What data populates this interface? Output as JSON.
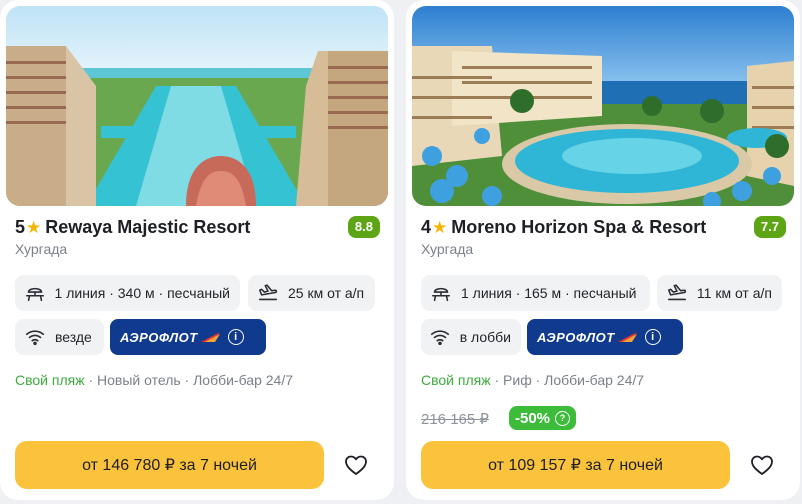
{
  "cards": [
    {
      "stars": "5",
      "name": "Rewaya Majestic Resort",
      "rating": "8.8",
      "city": "Хургада",
      "beach": "1 линия · 340 м · песчаный",
      "airport": "25 км от а/п",
      "wifi": "везде",
      "airline": "АЭРОФЛОТ",
      "features_beach": "Свой пляж",
      "features_rest": " · Новый отель · Лобби-бар 24/7",
      "price": "от 146 780 ₽ за 7 ночей"
    },
    {
      "stars": "4",
      "name": "Moreno Horizon Spa & Resort",
      "rating": "7.7",
      "city": "Хургада",
      "beach": "1 линия · 165 м · песчаный",
      "airport": "11 км от а/п",
      "wifi": "в лобби",
      "airline": "АЭРОФЛОТ",
      "features_beach": "Свой пляж",
      "features_rest": " · Риф · Лобби-бар 24/7",
      "old_price": "216 165 ₽",
      "discount": "-50%",
      "price": "от 109 157 ₽ за 7 ночей"
    }
  ],
  "icons": {
    "star": "star-icon",
    "beach": "sunbed-icon",
    "airport": "plane-landing-icon",
    "wifi": "wifi-icon",
    "favorite": "heart-icon",
    "info": "info-icon"
  },
  "colors": {
    "rating_bg": "#5ea516",
    "price_button": "#fbc23b",
    "airline_bg": "#0f3a8e",
    "discount_bg": "#3dbb3a",
    "feature_green": "#3dac3b"
  }
}
